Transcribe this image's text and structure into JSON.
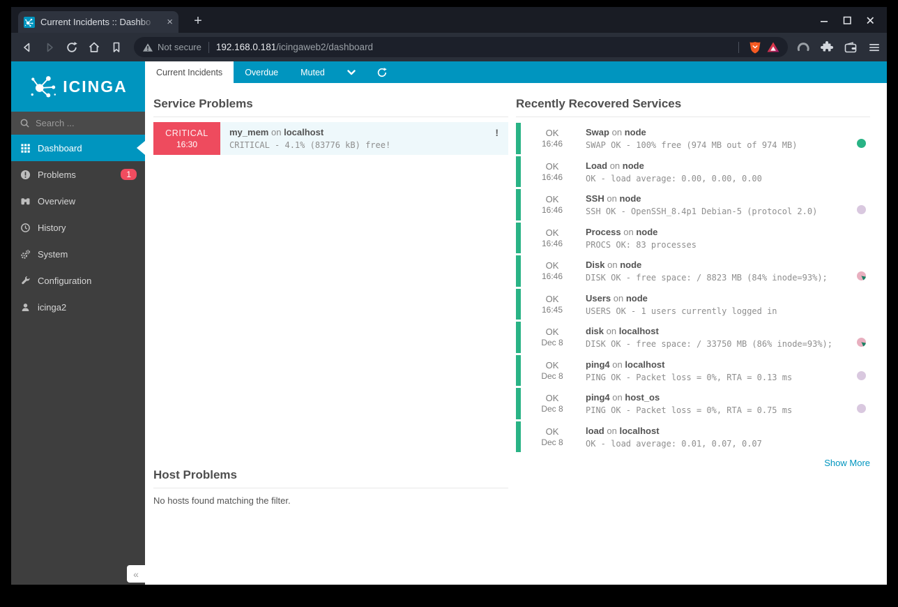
{
  "browser": {
    "tab_title": "Current Incidents :: Dashbo",
    "not_secure": "Not secure",
    "url_host": "192.168.0.181",
    "url_path": "/icingaweb2/dashboard"
  },
  "icons": {
    "tab_close": "×",
    "new_tab": "+",
    "collapse": "«",
    "priority": "!"
  },
  "labels": {
    "on": "on"
  },
  "sidebar": {
    "brand": "ICINGA",
    "search_placeholder": "Search ...",
    "items": [
      {
        "label": "Dashboard",
        "icon": "dashboard-grid",
        "active": true
      },
      {
        "label": "Problems",
        "icon": "exclamation-circle",
        "badge": "1"
      },
      {
        "label": "Overview",
        "icon": "binoculars"
      },
      {
        "label": "History",
        "icon": "history-clock"
      },
      {
        "label": "System",
        "icon": "gears"
      },
      {
        "label": "Configuration",
        "icon": "wrench"
      },
      {
        "label": "icinga2",
        "icon": "user"
      }
    ]
  },
  "tabbar": {
    "tabs": [
      {
        "label": "Current Incidents",
        "active": true
      },
      {
        "label": "Overdue"
      },
      {
        "label": "Muted"
      }
    ]
  },
  "service_problems": {
    "title": "Service Problems",
    "row": {
      "state": "CRITICAL",
      "time": "16:30",
      "service": "my_mem",
      "host": "localhost",
      "output": "CRITICAL - 4.1% (83776 kB) free!"
    }
  },
  "recovered": {
    "title": "Recently Recovered Services",
    "show_more": "Show More",
    "rows": [
      {
        "state": "OK",
        "time": "16:46",
        "service": "Swap",
        "host": "node",
        "output": "SWAP OK - 100% free (974 MB out of 974 MB)",
        "dot": "green"
      },
      {
        "state": "OK",
        "time": "16:46",
        "service": "Load",
        "host": "node",
        "output": "OK - load average: 0.00, 0.00, 0.00",
        "dot": "none"
      },
      {
        "state": "OK",
        "time": "16:46",
        "service": "SSH",
        "host": "node",
        "output": "SSH OK - OpenSSH_8.4p1 Debian-5 (protocol 2.0)",
        "dot": "lavender"
      },
      {
        "state": "OK",
        "time": "16:46",
        "service": "Process",
        "host": "node",
        "output": "PROCS OK: 83 processes",
        "dot": "none"
      },
      {
        "state": "OK",
        "time": "16:46",
        "service": "Disk",
        "host": "node",
        "output": "DISK OK - free space: / 8823 MB (84% inode=93%);",
        "dot": "pie"
      },
      {
        "state": "OK",
        "time": "16:45",
        "service": "Users",
        "host": "node",
        "output": "USERS OK - 1 users currently logged in",
        "dot": "none"
      },
      {
        "state": "OK",
        "time": "Dec 8",
        "service": "disk",
        "host": "localhost",
        "output": "DISK OK - free space: / 33750 MB (86% inode=93%);",
        "dot": "pie"
      },
      {
        "state": "OK",
        "time": "Dec 8",
        "service": "ping4",
        "host": "localhost",
        "output": "PING OK - Packet loss = 0%, RTA = 0.13 ms",
        "dot": "lavender"
      },
      {
        "state": "OK",
        "time": "Dec 8",
        "service": "ping4",
        "host": "host_os",
        "output": "PING OK - Packet loss = 0%, RTA = 0.75 ms",
        "dot": "lavender"
      },
      {
        "state": "OK",
        "time": "Dec 8",
        "service": "load",
        "host": "localhost",
        "output": "OK - load average: 0.01, 0.07, 0.07",
        "dot": "none"
      }
    ]
  },
  "host_problems": {
    "title": "Host Problems",
    "empty_message": "No hosts found matching the filter."
  },
  "status_colors": {
    "accent_teal": "#0095bf",
    "critical_red": "#ee4b5e",
    "ok_green": "#29b385",
    "badge_red": "#f14c5f",
    "perf_lavender": "#d9c8df"
  }
}
